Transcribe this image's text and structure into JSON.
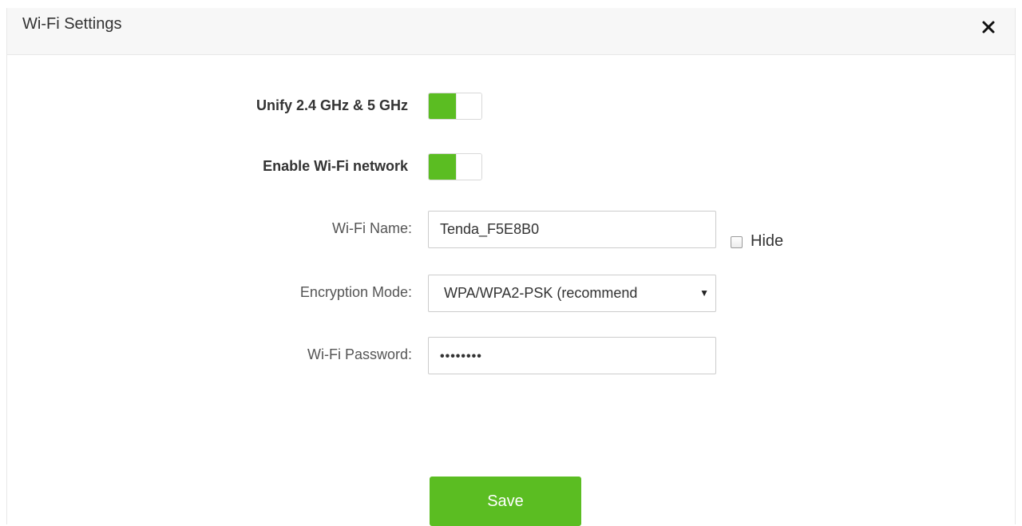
{
  "dialog": {
    "title": "Wi-Fi Settings",
    "close_icon": "close-icon"
  },
  "form": {
    "unify": {
      "label": "Unify 2.4 GHz & 5 GHz",
      "enabled": true
    },
    "enable_wifi": {
      "label": "Enable Wi-Fi network",
      "enabled": true
    },
    "wifi_name": {
      "label": "Wi-Fi Name:",
      "value": "Tenda_F5E8B0",
      "hide_label": "Hide",
      "hide_checked": false
    },
    "encryption": {
      "label": "Encryption Mode:",
      "value": "WPA/WPA2-PSK (recommend",
      "arrow": "▼"
    },
    "password": {
      "label": "Wi-Fi Password:",
      "value": "••••••••"
    }
  },
  "actions": {
    "save_label": "Save"
  },
  "colors": {
    "accent": "#5bbd22",
    "header_bg": "#f7f7f7"
  }
}
